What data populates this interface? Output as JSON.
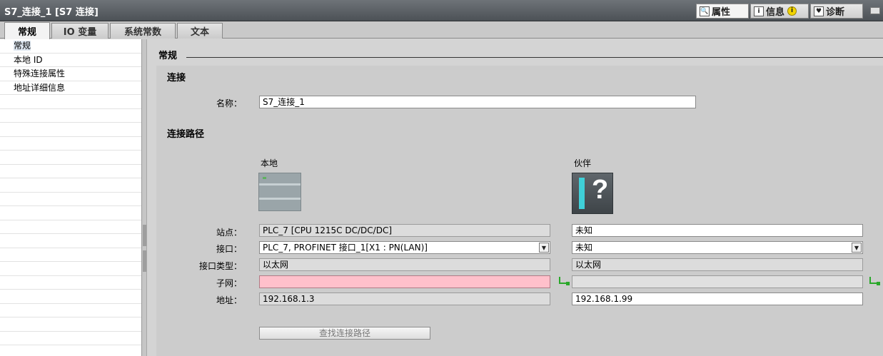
{
  "window": {
    "title": "S7_连接_1 [S7 连接]",
    "tabs": [
      {
        "label": "属性",
        "icon": "properties-icon",
        "icon_glyph": "🔍"
      },
      {
        "label": "信息",
        "icon": "info-icon",
        "icon_glyph": "i",
        "badge": "i"
      },
      {
        "label": "诊断",
        "icon": "diagnostics-icon",
        "icon_glyph": "♥"
      }
    ]
  },
  "subtabs": [
    "常规",
    "IO 变量",
    "系统常数",
    "文本"
  ],
  "sidebar": {
    "items": [
      "常规",
      "本地 ID",
      "特殊连接属性",
      "地址详细信息"
    ]
  },
  "main": {
    "heading": "常规",
    "section_connection": "连接",
    "name_label": "名称：",
    "name_value": "S7_连接_1",
    "section_path": "连接路径",
    "local_header": "本地",
    "partner_header": "伙伴",
    "rows": {
      "station_label": "站点：",
      "interface_label": "接口：",
      "iftype_label": "接口类型：",
      "subnet_label": "子网：",
      "address_label": "地址："
    },
    "local": {
      "station": "PLC_7 [CPU 1215C DC/DC/DC]",
      "interface": "PLC_7, PROFINET 接口_1[X1 : PN(LAN)]",
      "iftype": "以太网",
      "subnet": "",
      "address": "192.168.1.3"
    },
    "partner": {
      "station": "未知",
      "interface": "未知",
      "iftype": "以太网",
      "subnet": "",
      "address": "192.168.1.99"
    },
    "find_path_button": "查找连接路径"
  },
  "colors": {
    "titlebar": "#5a5f64",
    "subnet_error": "#ffc0cb",
    "network_icon": "#2aa82a",
    "partner_accent": "#3fd0d8"
  }
}
